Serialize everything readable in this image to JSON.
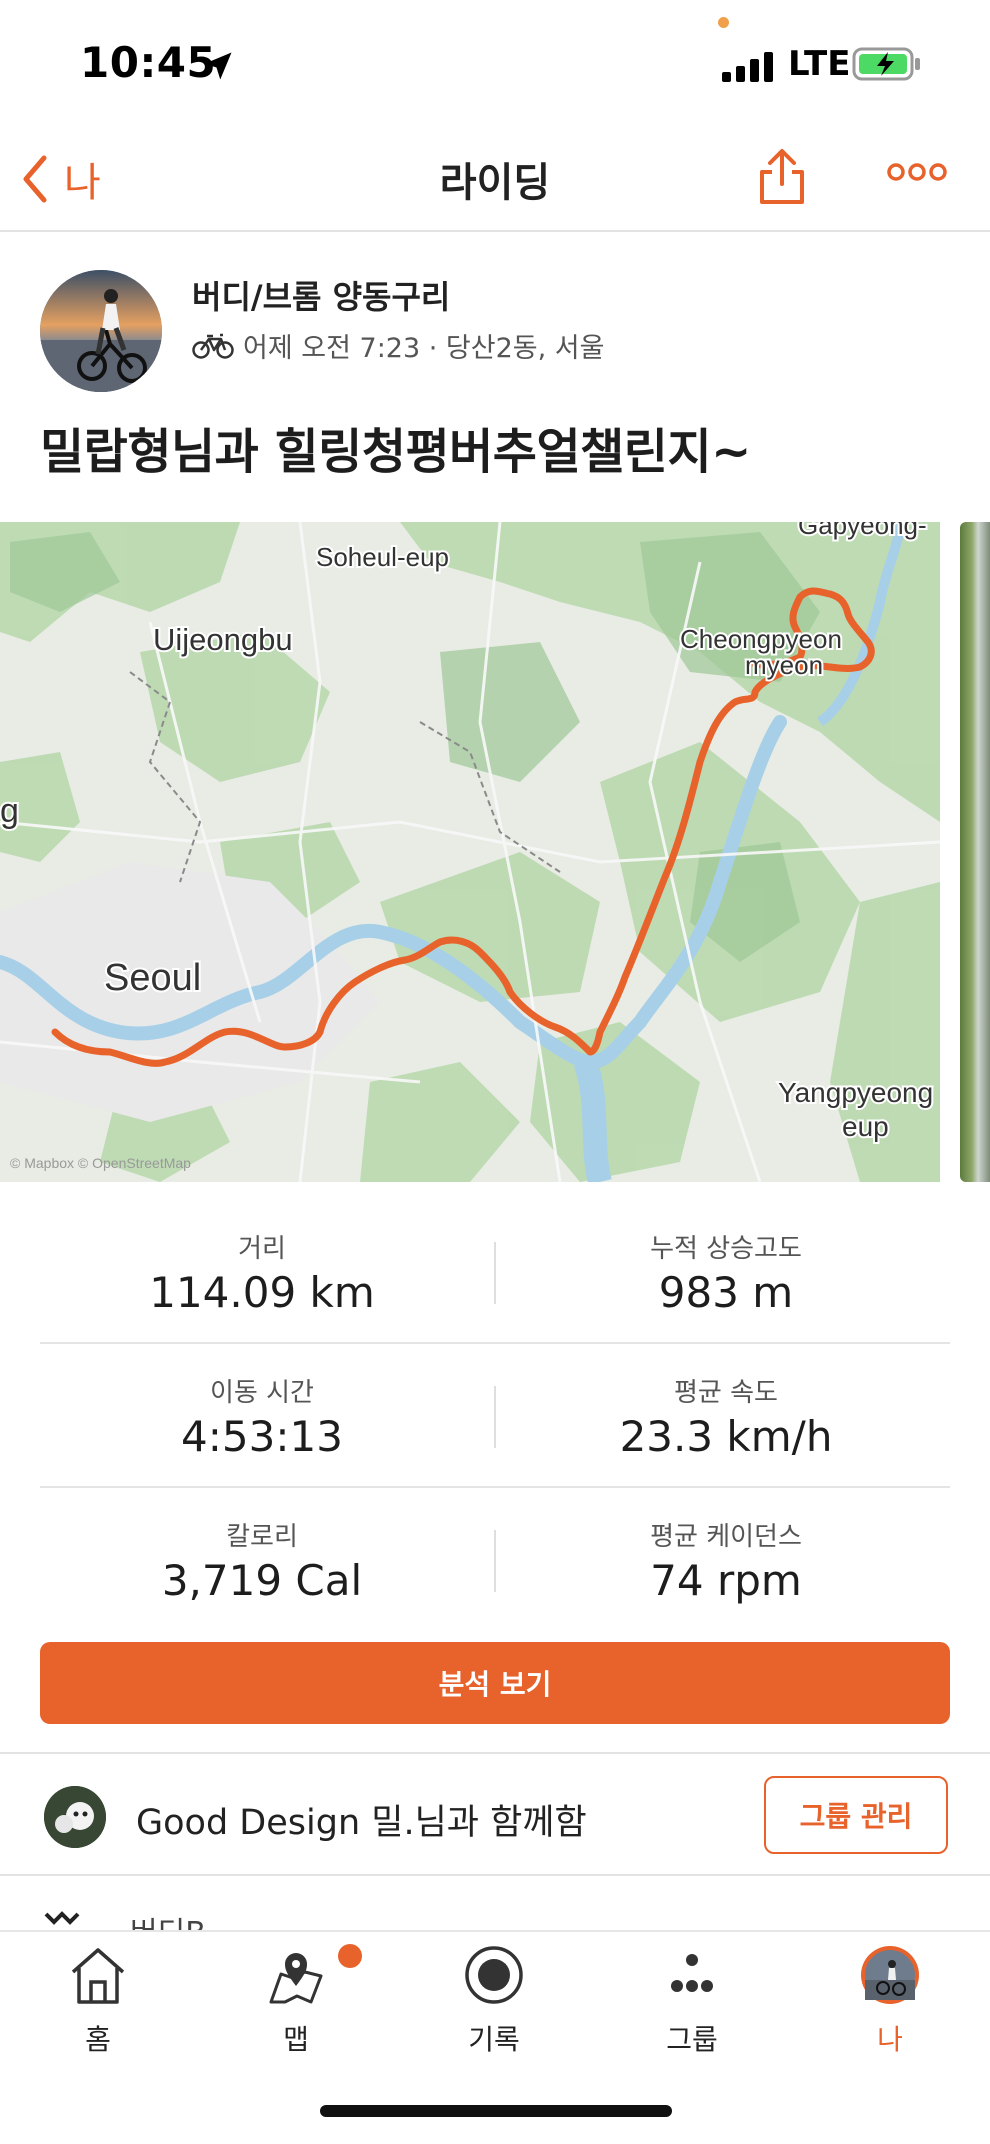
{
  "status_bar": {
    "time": "10:45",
    "network": "LTE"
  },
  "nav": {
    "back_label": "나",
    "title": "라이딩"
  },
  "athlete": {
    "name": "버디/브롬 양동구리",
    "activity_meta": "어제 오전 7:23 · 당산2동, 서울"
  },
  "activity": {
    "title": "밀랍형님과 힐링청평버추얼챌린지~"
  },
  "map": {
    "labels": {
      "gapyeong": "Gapyeong-",
      "soheul": "Soheul-eup",
      "uijeongbu": "Uijeongbu",
      "cheongpyeon": "Cheongpyeon",
      "myeon": "myeon",
      "g": "g",
      "seoul": "Seoul",
      "yangpyeong": "Yangpyeong",
      "eup": "eup",
      "attribution": "© Mapbox © OpenStreetMap"
    },
    "route_color": "#E8622C"
  },
  "stats": {
    "distance": {
      "label": "거리",
      "value": "114.09 km"
    },
    "elevation": {
      "label": "누적 상승고도",
      "value": "983 m"
    },
    "moving_time": {
      "label": "이동 시간",
      "value": "4:53:13"
    },
    "avg_speed": {
      "label": "평균 속도",
      "value": "23.3 km/h"
    },
    "calories": {
      "label": "칼로리",
      "value": "3,719 Cal"
    },
    "avg_cadence": {
      "label": "평균 케이던스",
      "value": "74 rpm"
    }
  },
  "buttons": {
    "analysis": "분석 보기",
    "group_manage": "그룹 관리"
  },
  "group": {
    "text": "Good Design 밀.님과 함께함"
  },
  "peek": {
    "text": "버디B"
  },
  "tabs": [
    {
      "label": "홈",
      "icon": "home-icon"
    },
    {
      "label": "맵",
      "icon": "map-icon"
    },
    {
      "label": "기록",
      "icon": "record-icon"
    },
    {
      "label": "그룹",
      "icon": "groups-icon"
    },
    {
      "label": "나",
      "icon": "profile-avatar"
    }
  ],
  "colors": {
    "accent": "#E8622C",
    "text": "#222222",
    "muted": "#555555"
  }
}
